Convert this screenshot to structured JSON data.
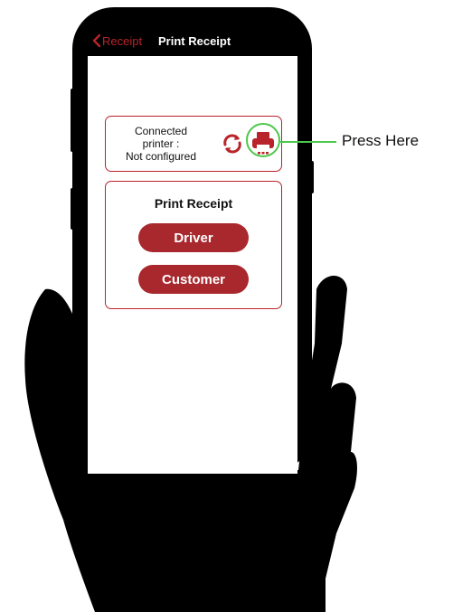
{
  "header": {
    "back_label": "Receipt",
    "title": "Print Receipt"
  },
  "printer_status": {
    "line1": "Connected",
    "line2": "printer :",
    "line3": "Not configured"
  },
  "print_section": {
    "title": "Print Receipt",
    "driver_label": "Driver",
    "customer_label": "Customer"
  },
  "annotation": {
    "label": "Press Here"
  },
  "icons": {
    "back": "chevron-left-icon",
    "refresh": "refresh-icon",
    "printer": "printer-icon"
  },
  "colors": {
    "accent": "#b8242a",
    "button": "#a8282d",
    "highlight": "#4cc84a"
  }
}
